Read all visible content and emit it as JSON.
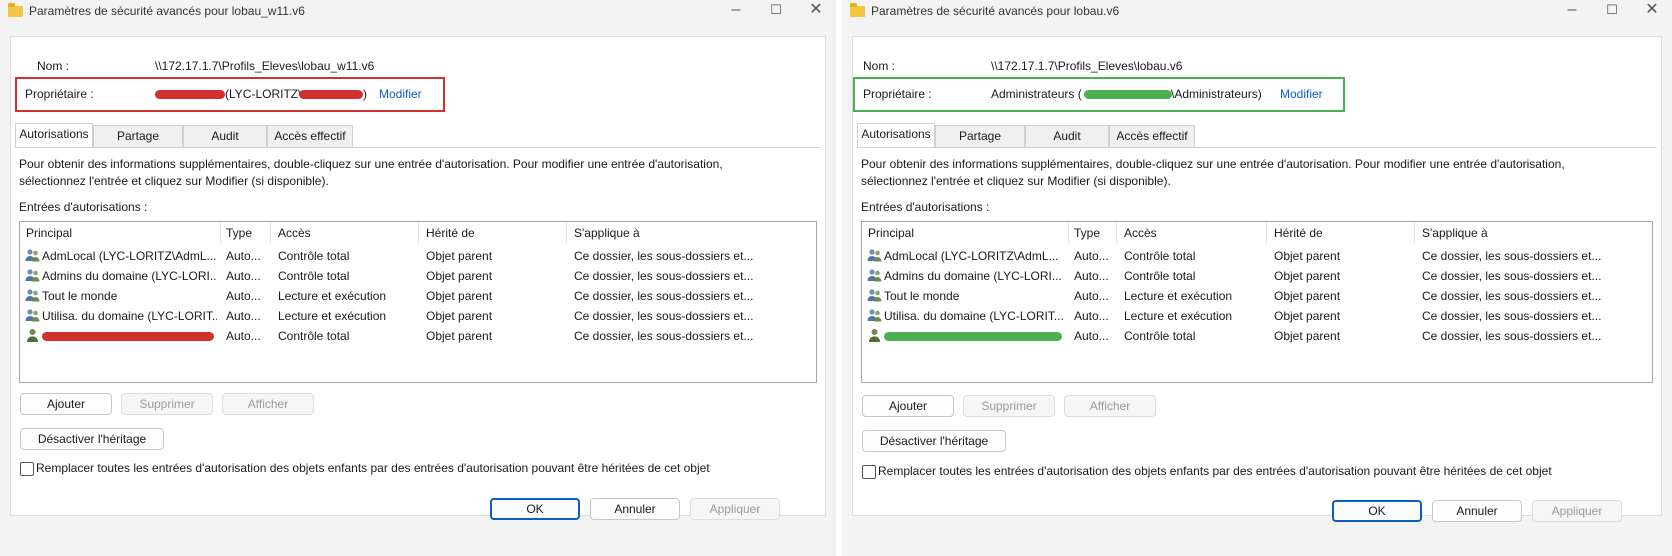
{
  "left": {
    "title": "Paramètres de sécurité avancés pour lobau_w11.v6",
    "name_label": "Nom :",
    "name_value": "\\\\172.17.1.7\\Profils_Eleves\\lobau_w11.v6",
    "owner_label": "Propriétaire :",
    "owner_value_prefix": "",
    "owner_value_mid": "(LYC-LORITZ\\",
    "owner_value_suffix": ")",
    "owner_modify": "Modifier",
    "highlight_color": "#d0312d",
    "tabs": [
      "Autorisations",
      "Partage",
      "Audit",
      "Accès effectif"
    ],
    "info_line1": "Pour obtenir des informations supplémentaires, double-cliquez sur une entrée d'autorisation. Pour modifier une entrée d'autorisation,",
    "info_line2": "sélectionnez l'entrée et cliquez sur Modifier (si disponible).",
    "entries_label": "Entrées d'autorisations :",
    "columns": [
      "Principal",
      "Type",
      "Accès",
      "Hérité de",
      "S'applique à"
    ],
    "rows": [
      {
        "principal": "AdmLocal (LYC-LORITZ\\AdmL...",
        "type": "Auto...",
        "access": "Contrôle total",
        "inherited": "Objet parent",
        "applies": "Ce dossier, les sous-dossiers et..."
      },
      {
        "principal": "Admins du domaine (LYC-LORI...",
        "type": "Auto...",
        "access": "Contrôle total",
        "inherited": "Objet parent",
        "applies": "Ce dossier, les sous-dossiers et..."
      },
      {
        "principal": "Tout le monde",
        "type": "Auto...",
        "access": "Lecture et exécution",
        "inherited": "Objet parent",
        "applies": "Ce dossier, les sous-dossiers et..."
      },
      {
        "principal": "Utilisa. du domaine (LYC-LORIT...",
        "type": "Auto...",
        "access": "Lecture et exécution",
        "inherited": "Objet parent",
        "applies": "Ce dossier, les sous-dossiers et..."
      },
      {
        "principal": "",
        "type": "Auto...",
        "access": "Contrôle total",
        "inherited": "Objet parent",
        "applies": "Ce dossier, les sous-dossiers et..."
      }
    ],
    "btn_add": "Ajouter",
    "btn_remove": "Supprimer",
    "btn_view": "Afficher",
    "btn_disable_inherit": "Désactiver l'héritage",
    "replace_label": "Remplacer toutes les entrées d'autorisation des objets enfants par des entrées d'autorisation pouvant être héritées de cet objet",
    "btn_ok": "OK",
    "btn_cancel": "Annuler",
    "btn_apply": "Appliquer"
  },
  "right": {
    "title": "Paramètres de sécurité avancés pour lobau.v6",
    "name_label": "Nom :",
    "name_value": "\\\\172.17.1.7\\Profils_Eleves\\lobau.v6",
    "owner_label": "Propriétaire :",
    "owner_value_prefix": "Administrateurs (",
    "owner_value_mid": "",
    "owner_value_suffix": "\\Administrateurs)",
    "owner_modify": "Modifier",
    "highlight_color": "#4caf50",
    "tabs": [
      "Autorisations",
      "Partage",
      "Audit",
      "Accès effectif"
    ],
    "info_line1": "Pour obtenir des informations supplémentaires, double-cliquez sur une entrée d'autorisation. Pour modifier une entrée d'autorisation,",
    "info_line2": "sélectionnez l'entrée et cliquez sur Modifier (si disponible).",
    "entries_label": "Entrées d'autorisations :",
    "columns": [
      "Principal",
      "Type",
      "Accès",
      "Hérité de",
      "S'applique à"
    ],
    "rows": [
      {
        "principal": "AdmLocal (LYC-LORITZ\\AdmL...",
        "type": "Auto...",
        "access": "Contrôle total",
        "inherited": "Objet parent",
        "applies": "Ce dossier, les sous-dossiers et..."
      },
      {
        "principal": "Admins du domaine (LYC-LORI...",
        "type": "Auto...",
        "access": "Contrôle total",
        "inherited": "Objet parent",
        "applies": "Ce dossier, les sous-dossiers et..."
      },
      {
        "principal": "Tout le monde",
        "type": "Auto...",
        "access": "Lecture et exécution",
        "inherited": "Objet parent",
        "applies": "Ce dossier, les sous-dossiers et..."
      },
      {
        "principal": "Utilisa. du domaine (LYC-LORIT...",
        "type": "Auto...",
        "access": "Lecture et exécution",
        "inherited": "Objet parent",
        "applies": "Ce dossier, les sous-dossiers et..."
      },
      {
        "principal": "",
        "type": "Auto...",
        "access": "Contrôle total",
        "inherited": "Objet parent",
        "applies": "Ce dossier, les sous-dossiers et..."
      }
    ],
    "btn_add": "Ajouter",
    "btn_remove": "Supprimer",
    "btn_view": "Afficher",
    "btn_disable_inherit": "Désactiver l'héritage",
    "replace_label": "Remplacer toutes les entrées d'autorisation des objets enfants par des entrées d'autorisation pouvant être héritées de cet objet",
    "btn_ok": "OK",
    "btn_cancel": "Annuler",
    "btn_apply": "Appliquer"
  }
}
